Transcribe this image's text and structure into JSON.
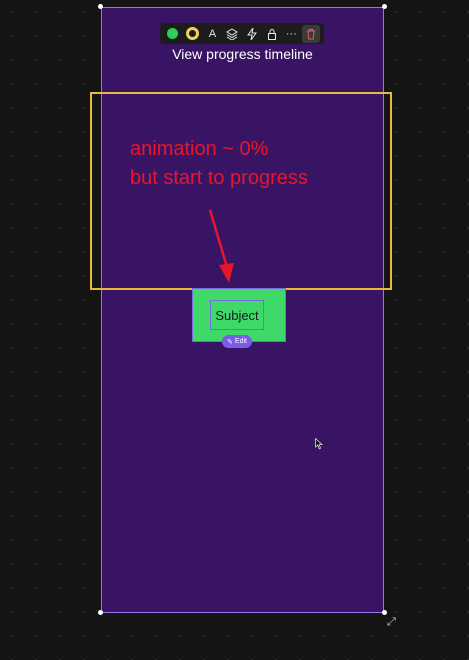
{
  "frame": {
    "title": "View progress timeline",
    "background": "#3a1464"
  },
  "toolbar": {
    "items": [
      {
        "icon": "green-circle-icon"
      },
      {
        "icon": "yellow-ring-icon"
      },
      {
        "icon": "text-icon",
        "glyph": "A"
      },
      {
        "icon": "layers-icon"
      },
      {
        "icon": "lightning-icon"
      },
      {
        "icon": "lock-icon"
      },
      {
        "icon": "more-icon",
        "glyph": "···"
      },
      {
        "icon": "trash-icon"
      }
    ]
  },
  "annotation": {
    "line1": "animation ~ 0%",
    "line2": "but start to progress",
    "color": "#e6172a",
    "box_color": "#e8b93c"
  },
  "node": {
    "label": "Subject",
    "edit_label": "Edit",
    "color": "#3fd96a"
  }
}
